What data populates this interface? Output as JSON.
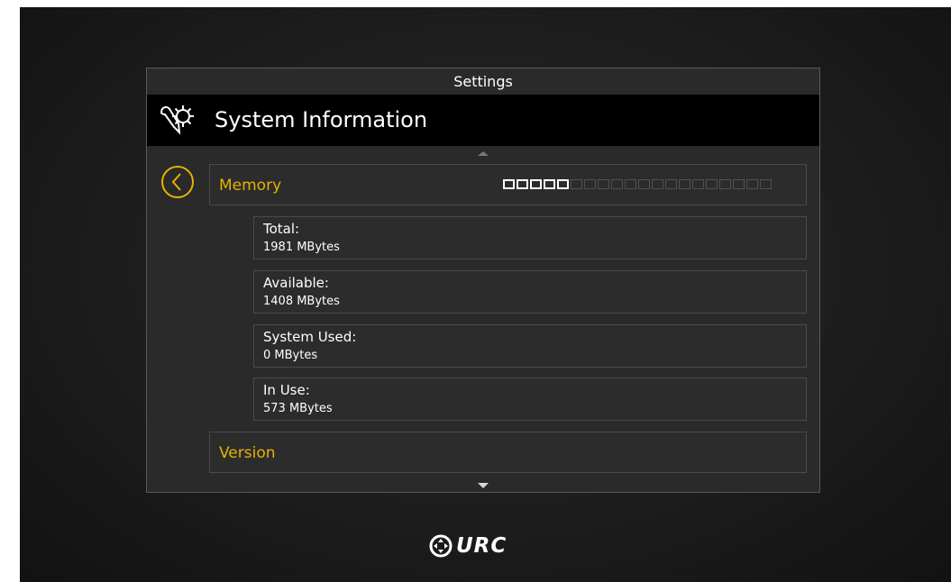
{
  "panel": {
    "title": "Settings",
    "header_title": "System Information",
    "header_icon": "settings-tools-icon"
  },
  "nav": {
    "back_icon": "chevron-left-icon",
    "scroll_up_icon": "scroll-up-icon",
    "scroll_down_icon": "scroll-down-icon"
  },
  "memory": {
    "label": "Memory",
    "usage_meter": {
      "filled": 5,
      "total": 20
    },
    "items": [
      {
        "label": "Total:",
        "value": "1981 MBytes"
      },
      {
        "label": "Available:",
        "value": "1408 MBytes"
      },
      {
        "label": "System Used:",
        "value": "0 MBytes"
      },
      {
        "label": "In Use:",
        "value": "573 MBytes"
      }
    ]
  },
  "version": {
    "label": "Version"
  },
  "brand": {
    "name": "URC",
    "logo_icon": "urc-logo-icon"
  },
  "colors": {
    "accent": "#e5b300",
    "background": "#1e1e1e",
    "panel": "#2a2a2a",
    "header": "#000000"
  }
}
